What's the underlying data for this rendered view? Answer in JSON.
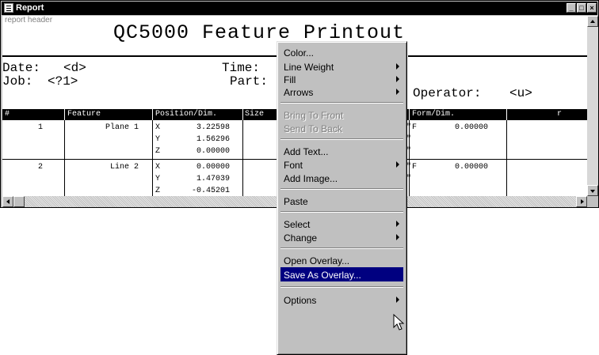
{
  "window": {
    "title": "Report",
    "controls": {
      "minimize": "_",
      "maximize": "□",
      "close": "×"
    }
  },
  "report": {
    "header_label": "report header",
    "title": "QC5000 Feature Printout",
    "fields": {
      "date_label": "Date:",
      "date_value": "<d>",
      "time_label": "Time:",
      "job_label": "Job:",
      "job_value": "<?1>",
      "part_label": "Part:",
      "operator_label": "Operator:",
      "operator_value": "<u>"
    },
    "columns": [
      "#",
      "Feature",
      "Position/Dim.",
      "Size",
      "Form/Dim.",
      "r"
    ],
    "rows": [
      {
        "num": "1",
        "feature": "Plane 1",
        "axes": [
          "X",
          "Y",
          "Z"
        ],
        "values": [
          "3.22598",
          "1.56296",
          "0.00000"
        ],
        "form_axis": "F",
        "form_value": "0.00000"
      },
      {
        "num": "2",
        "feature": "Line 2",
        "axes": [
          "X",
          "Y",
          "Z"
        ],
        "values": [
          "0.00000",
          "1.47039",
          "-0.45201"
        ],
        "form_axis": "F",
        "form_value": "0.00000"
      }
    ],
    "quote_mark": "\""
  },
  "context_menu": {
    "items": [
      {
        "label": "Color...",
        "submenu": false,
        "enabled": true
      },
      {
        "label": "Line Weight",
        "submenu": true,
        "enabled": true
      },
      {
        "label": "Fill",
        "submenu": true,
        "enabled": true
      },
      {
        "label": "Arrows",
        "submenu": true,
        "enabled": true
      },
      {
        "label": "Bring To Front",
        "submenu": false,
        "enabled": false
      },
      {
        "label": "Send To Back",
        "submenu": false,
        "enabled": false
      },
      {
        "label": "Add Text...",
        "submenu": false,
        "enabled": true
      },
      {
        "label": "Font",
        "submenu": true,
        "enabled": true
      },
      {
        "label": "Add Image...",
        "submenu": false,
        "enabled": true
      },
      {
        "label": "Paste",
        "submenu": false,
        "enabled": true
      },
      {
        "label": "Select",
        "submenu": true,
        "enabled": true
      },
      {
        "label": "Change",
        "submenu": true,
        "enabled": true
      },
      {
        "label": "Open Overlay...",
        "submenu": false,
        "enabled": true
      },
      {
        "label": "Save As Overlay...",
        "submenu": false,
        "enabled": true,
        "highlighted": true
      },
      {
        "label": "Options",
        "submenu": true,
        "enabled": true
      }
    ]
  },
  "colors": {
    "titlebar": "#000000",
    "menu_highlight": "#000080",
    "menu_face": "#c0c0c0"
  },
  "icons": [
    "report-app-icon",
    "scroll-up-icon",
    "scroll-down-icon",
    "scroll-left-icon",
    "scroll-right-icon",
    "mouse-pointer-icon"
  ]
}
